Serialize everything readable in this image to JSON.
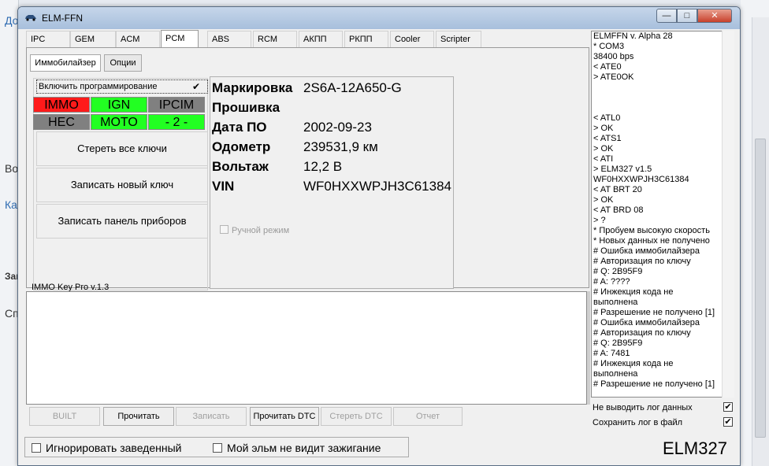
{
  "window": {
    "title": "ELM-FFN",
    "min": "—",
    "max": "□",
    "close": "✕"
  },
  "background": {
    "left_items": [
      "До",
      "Во",
      "Ка",
      "Зак",
      "Сп"
    ]
  },
  "tabs": [
    "IPC",
    "GEM",
    "ACM",
    "PCM",
    "ABS",
    "RCM",
    "АКПП",
    "РКПП",
    "Cooler",
    "Scripter"
  ],
  "active_tab": "PCM",
  "subtabs": [
    "Иммобилайзер",
    "Опции"
  ],
  "immo": {
    "enable_label": "Включить программирование",
    "enable_checked": "✔",
    "indicators": [
      {
        "label": "IMMO",
        "color": "#ff1a1a"
      },
      {
        "label": "IGN",
        "color": "#22ff22"
      },
      {
        "label": "IPCIM",
        "color": "#808080"
      },
      {
        "label": "HEC",
        "color": "#808080"
      },
      {
        "label": "MOTO",
        "color": "#22ff22"
      },
      {
        "label": "- 2 -",
        "color": "#22ff22"
      }
    ],
    "erase_keys": "Стереть все ключи",
    "write_key": "Записать новый ключ",
    "write_panel": "Записать панель приборов",
    "version": "IMMO Key Pro v.1.3"
  },
  "info": {
    "rows": [
      {
        "label": "Маркировка",
        "value": "2S6A-12A650-G"
      },
      {
        "label": "Прошивка",
        "value": ""
      },
      {
        "label": "Дата ПО",
        "value": "2002-09-23"
      },
      {
        "label": "Одометр",
        "value": "239531,9 км"
      },
      {
        "label": "Вольтаж",
        "value": "12,2 В"
      },
      {
        "label": "VIN",
        "value": "WF0HXXWPJH3C61384"
      }
    ],
    "manual_mode": "Ручной режим"
  },
  "buttons": {
    "built": "BUILT",
    "read": "Прочитать",
    "write": "Записать",
    "read_dtc": "Прочитать DTC",
    "clear_dtc": "Стереть DTC",
    "report": "Отчет"
  },
  "bottom": {
    "ignore_running": "Игнорировать заведенный",
    "no_ignition": "Мой эльм не видит зажигание",
    "adapter": "ELM327"
  },
  "log": {
    "lines": [
      "ELMFFN v. Alpha 28",
      "* COM3",
      "38400 bps",
      "< ATE0",
      "> ATE0OK",
      "",
      "",
      "",
      "< ATL0",
      "> OK",
      "< ATS1",
      "> OK",
      "< ATI",
      "> ELM327 v1.5",
      "WF0HXXWPJH3C61384",
      "< AT BRT 20",
      "> OK",
      "< AT BRD 08",
      "> ?",
      "* Пробуем высокую скорость",
      "* Новых данных не получено",
      "# Ошибка иммобилайзера",
      "# Авторизация по ключу",
      "# Q: 2B95F9",
      "# A: ????",
      "# Инжекция кода не",
      "выполнена",
      "# Разрешение не получено [1]",
      "# Ошибка иммобилайзера",
      "# Авторизация по ключу",
      "# Q: 2B95F9",
      "# A: 7481",
      "# Инжекция кода не",
      "выполнена",
      "# Разрешение не получено [1]"
    ],
    "no_log": "Не выводить лог данных",
    "save_log": "Сохранить лог в файл",
    "check": "✔"
  }
}
